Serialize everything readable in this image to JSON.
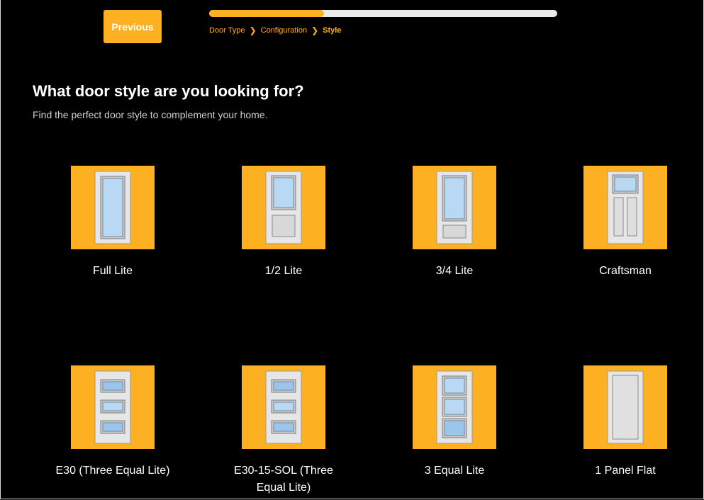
{
  "nav": {
    "previous_label": "Previous"
  },
  "progress": {
    "fraction": 0.33
  },
  "breadcrumb": {
    "step1": "Door Type",
    "step2": "Configuration",
    "step3": "Style"
  },
  "header": {
    "title": "What door style are you looking for?",
    "subtitle": "Find the perfect door style to complement your home."
  },
  "styles": [
    {
      "label": "Full Lite",
      "icon": "full-lite-door-icon"
    },
    {
      "label": "1/2 Lite",
      "icon": "half-lite-door-icon"
    },
    {
      "label": "3/4 Lite",
      "icon": "three-quarter-lite-door-icon"
    },
    {
      "label": "Craftsman",
      "icon": "craftsman-door-icon"
    },
    {
      "label": "E30 (Three Equal Lite)",
      "icon": "e30-three-equal-lite-door-icon"
    },
    {
      "label": "E30-15-SOL (Three Equal Lite)",
      "icon": "e30-15-sol-door-icon"
    },
    {
      "label": "3 Equal Lite",
      "icon": "three-equal-lite-door-icon"
    },
    {
      "label": "1 Panel Flat",
      "icon": "one-panel-flat-door-icon"
    }
  ],
  "colors": {
    "accent": "#fdb022",
    "background": "#000000",
    "track": "#ebebeb"
  }
}
